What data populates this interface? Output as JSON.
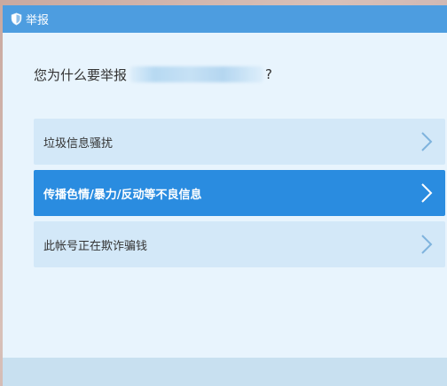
{
  "window": {
    "title": "举报",
    "title_icon": "shield-icon"
  },
  "question": {
    "prefix": "您为什么要举报",
    "suffix": "?"
  },
  "options": [
    {
      "label": "垃圾信息骚扰",
      "selected": false
    },
    {
      "label": "传播色情/暴力/反动等不良信息",
      "selected": true
    },
    {
      "label": "此帐号正在欺诈骗钱",
      "selected": false
    }
  ],
  "colors": {
    "titlebar": "#4d9de0",
    "window_bg": "#e8f4fd",
    "option_bg": "#d3e8f8",
    "option_selected_bg": "#2a8ce0",
    "footer_bg": "#c8e0f0"
  }
}
